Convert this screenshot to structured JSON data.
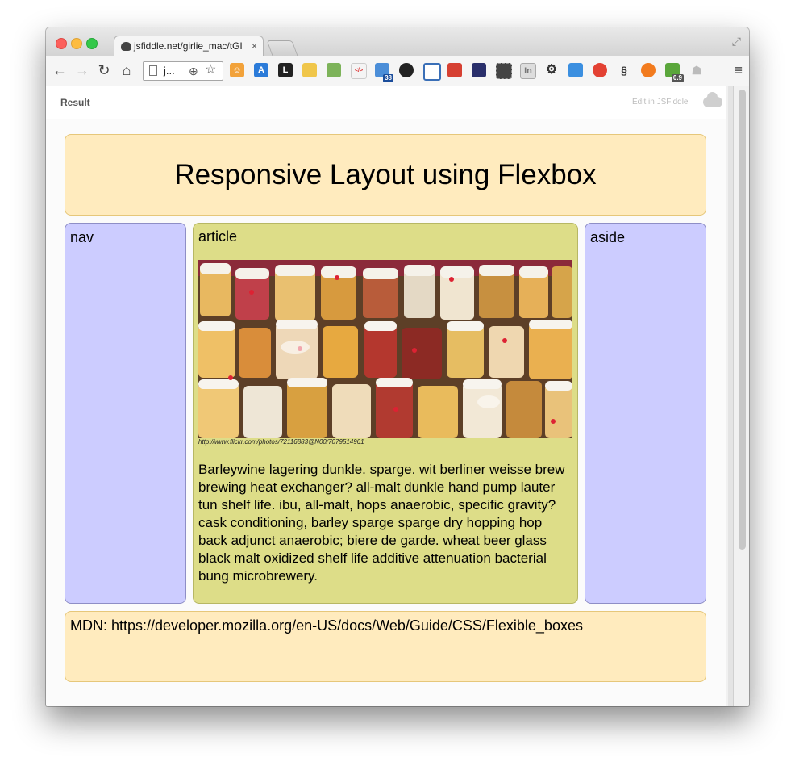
{
  "browser": {
    "tab_title": "jsfiddle.net/girlie_mac/tGI",
    "tab_close": "×",
    "url_text": "j...",
    "nav": {
      "back": "←",
      "forward": "→",
      "reload": "↻",
      "home": "⌂"
    },
    "menu_glyph": "≡",
    "extension_badge": "38",
    "extension_badge_2": "0.9"
  },
  "jsfiddle": {
    "result_label": "Result",
    "edit_link": "Edit in JSFiddle"
  },
  "page": {
    "header_title": "Responsive Layout using Flexbox",
    "nav_label": "nav",
    "article_label": "article",
    "aside_label": "aside",
    "photo_caption": "http://www.flickr.com/photos/72116883@N00/7079514961",
    "article_text": "Barleywine lagering dunkle. sparge. wit berliner weisse brew brewing heat exchanger? all-malt dunkle hand pump lauter tun shelf life. ibu, all-malt, hops anaerobic, specific gravity? cask conditioning, barley sparge sparge dry hopping hop back adjunct anaerobic; biere de garde. wheat beer glass black malt oxidized shelf life additive attenuation bacterial bung microbrewery.",
    "footer_text": "MDN: https://developer.mozilla.org/en-US/docs/Web/Guide/CSS/Flexible_boxes"
  },
  "colors": {
    "header_footer_bg": "#ffebbe",
    "nav_aside_bg": "#ccccff",
    "article_bg": "#dddd88"
  }
}
